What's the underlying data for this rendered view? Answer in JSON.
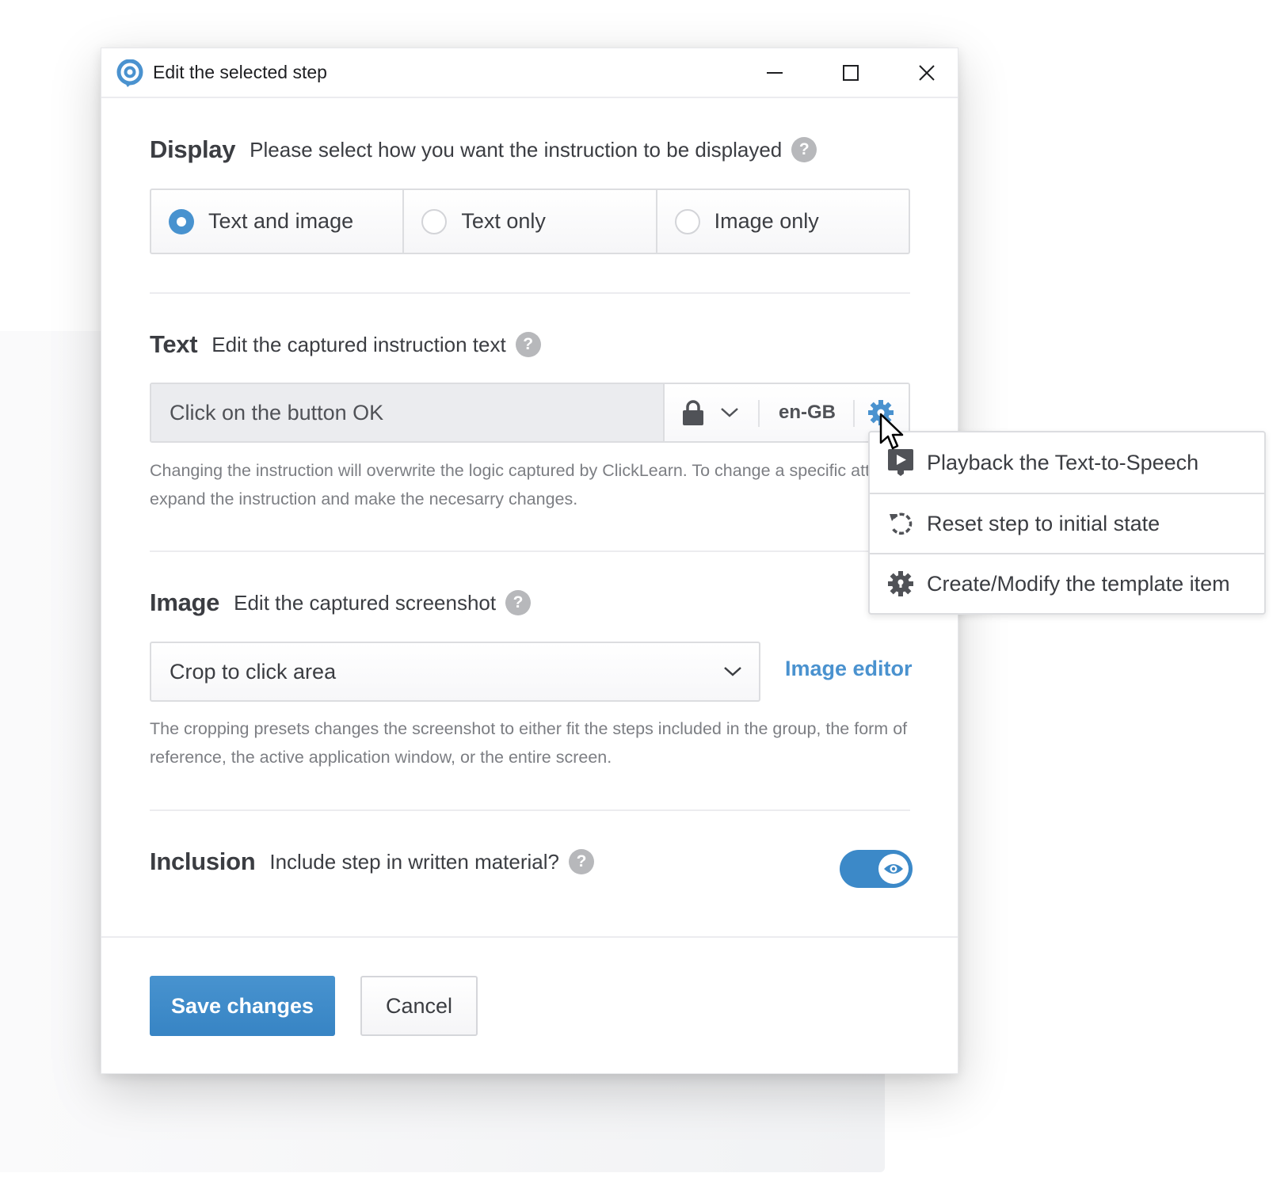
{
  "window": {
    "title": "Edit the selected step",
    "controls": {
      "minimize": "minimize-icon",
      "maximize": "maximize-icon",
      "close": "close-icon"
    }
  },
  "display": {
    "title": "Display",
    "subtitle": "Please select how you want the instruction to be displayed",
    "help": "?",
    "options": [
      {
        "label": "Text and image",
        "selected": true
      },
      {
        "label": "Text only",
        "selected": false
      },
      {
        "label": "Image only",
        "selected": false
      }
    ]
  },
  "text": {
    "title": "Text",
    "subtitle": "Edit the captured instruction text",
    "help": "?",
    "value": "Click on the button OK",
    "language": "en-GB",
    "hint": "Changing the instruction will overwrite the logic captured by ClickLearn. To change a specific attribute, expand the instruction and make the necesarry changes."
  },
  "image": {
    "title": "Image",
    "subtitle": "Edit the captured screenshot",
    "help": "?",
    "crop_selected": "Crop to click area",
    "editor_link": "Image editor",
    "hint": "The cropping presets changes the screenshot to either fit the steps included in the group, the form of reference, the active application window, or the entire screen."
  },
  "inclusion": {
    "title": "Inclusion",
    "subtitle": "Include step in written material?",
    "help": "?",
    "enabled": true
  },
  "footer": {
    "save_label": "Save changes",
    "cancel_label": "Cancel"
  },
  "context_menu": {
    "items": [
      {
        "label": "Playback the Text-to-Speech",
        "icon": "playback-icon"
      },
      {
        "label": "Reset step to initial state",
        "icon": "reset-icon"
      },
      {
        "label": "Create/Modify the template item",
        "icon": "template-gear-icon"
      }
    ]
  },
  "colors": {
    "accent": "#4a92cf",
    "primary_button": "#3c89c8",
    "text": "#3b3d42",
    "hint_text": "#7c7e83"
  }
}
